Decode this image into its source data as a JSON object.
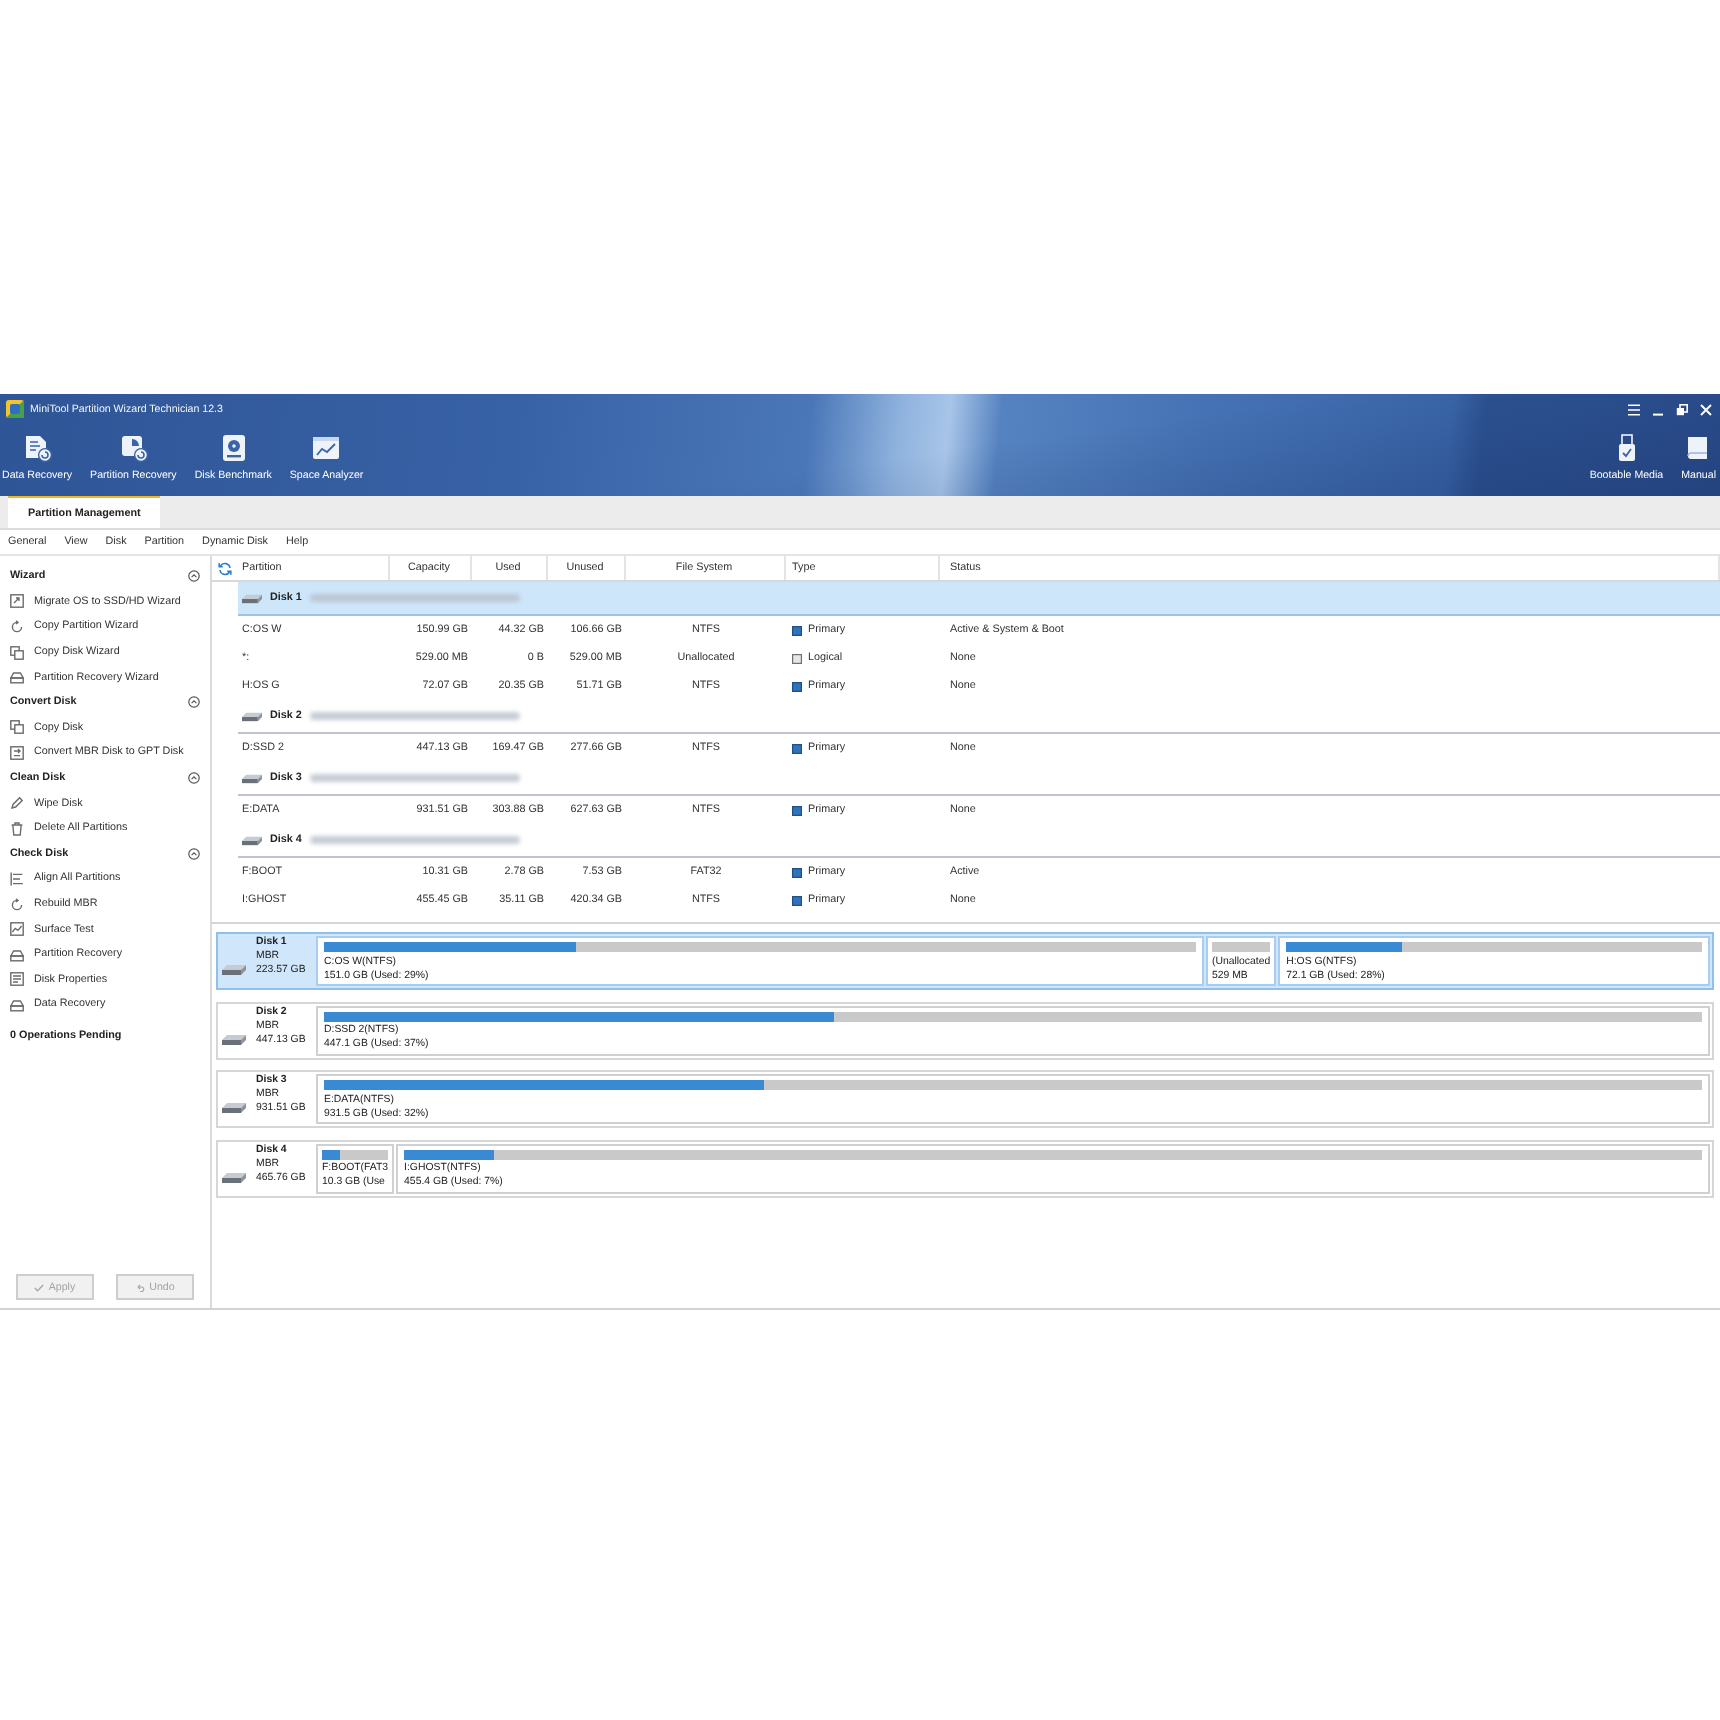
{
  "window": {
    "title": "MiniTool Partition Wizard Technician 12.3"
  },
  "toolbar": [
    "Data Recovery",
    "Partition Recovery",
    "Disk Benchmark",
    "Space Analyzer"
  ],
  "toolbar_right": [
    "Bootable Media",
    "Manual"
  ],
  "tabs": [
    {
      "label": "Partition Management",
      "selected": true
    }
  ],
  "menu": [
    "General",
    "View",
    "Disk",
    "Partition",
    "Dynamic Disk",
    "Help"
  ],
  "sidebar": {
    "groups": [
      {
        "title": "Wizard",
        "expanded": true,
        "items": [
          "Migrate OS to SSD/HD Wizard",
          "Copy Partition Wizard",
          "Copy Disk Wizard",
          "Partition Recovery Wizard"
        ]
      },
      {
        "title": "Convert Disk",
        "expanded": true,
        "items": [
          "Copy Disk",
          "Convert MBR Disk to GPT Disk"
        ]
      },
      {
        "title": "Clean Disk",
        "expanded": true,
        "items": [
          "Wipe Disk",
          "Delete All Partitions"
        ]
      },
      {
        "title": "Check Disk",
        "expanded": true,
        "items": [
          "Align All Partitions",
          "Rebuild MBR",
          "Surface Test",
          "Partition Recovery",
          "Disk Properties",
          "Data Recovery"
        ]
      }
    ],
    "pending": "0 Operations Pending",
    "buttons": [
      {
        "label": "Apply",
        "disabled": true
      },
      {
        "label": "Undo",
        "disabled": true
      }
    ]
  },
  "table": {
    "columns": [
      "Partition",
      "Capacity",
      "Used",
      "Unused",
      "File System",
      "Type",
      "Status"
    ],
    "disks": [
      {
        "name": "Disk 1",
        "selected": true,
        "partitions": [
          {
            "partition": "C:OS W",
            "capacity": "150.99 GB",
            "used": "44.32 GB",
            "unused": "106.66 GB",
            "file_system": "NTFS",
            "kind": "primary",
            "type": "Primary",
            "status": "Active & System & Boot"
          },
          {
            "partition": "*:",
            "capacity": "529.00 MB",
            "used": "0 B",
            "unused": "529.00 MB",
            "file_system": "Unallocated",
            "kind": "logical",
            "type": "Logical",
            "status": "None"
          },
          {
            "partition": "H:OS G",
            "capacity": "72.07 GB",
            "used": "20.35 GB",
            "unused": "51.71 GB",
            "file_system": "NTFS",
            "kind": "primary",
            "type": "Primary",
            "status": "None"
          }
        ]
      },
      {
        "name": "Disk 2",
        "selected": false,
        "partitions": [
          {
            "partition": "D:SSD 2",
            "capacity": "447.13 GB",
            "used": "169.47 GB",
            "unused": "277.66 GB",
            "file_system": "NTFS",
            "kind": "primary",
            "type": "Primary",
            "status": "None"
          }
        ]
      },
      {
        "name": "Disk 3",
        "selected": false,
        "partitions": [
          {
            "partition": "E:DATA",
            "capacity": "931.51 GB",
            "used": "303.88 GB",
            "unused": "627.63 GB",
            "file_system": "NTFS",
            "kind": "primary",
            "type": "Primary",
            "status": "None"
          }
        ]
      },
      {
        "name": "Disk 4",
        "selected": false,
        "partitions": [
          {
            "partition": "F:BOOT",
            "capacity": "10.31 GB",
            "used": "2.78 GB",
            "unused": "7.53 GB",
            "file_system": "FAT32",
            "kind": "primary",
            "type": "Primary",
            "status": "Active"
          },
          {
            "partition": "I:GHOST",
            "capacity": "455.45 GB",
            "used": "35.11 GB",
            "unused": "420.34 GB",
            "file_system": "NTFS",
            "kind": "primary",
            "type": "Primary",
            "status": "None"
          }
        ]
      }
    ]
  },
  "disk_map": [
    {
      "name": "Disk 1",
      "scheme": "MBR",
      "size": "223.57 GB",
      "selected": true,
      "partitions": [
        {
          "kind": "partition",
          "label": "C:OS W(NTFS)",
          "detail": "151.0 GB (Used: 29%)",
          "level": 0.29
        },
        {
          "kind": "unallocated",
          "label": "(Unallocated",
          "detail": "529 MB"
        },
        {
          "kind": "partition",
          "label": "H:OS G(NTFS)",
          "detail": "72.1 GB (Used: 28%)",
          "level": 0.28
        }
      ]
    },
    {
      "name": "Disk 2",
      "scheme": "MBR",
      "size": "447.13 GB",
      "selected": false,
      "partitions": [
        {
          "kind": "partition",
          "label": "D:SSD 2(NTFS)",
          "detail": "447.1 GB (Used: 37%)",
          "level": 0.37
        }
      ]
    },
    {
      "name": "Disk 3",
      "scheme": "MBR",
      "size": "931.51 GB",
      "selected": false,
      "partitions": [
        {
          "kind": "partition",
          "label": "E:DATA(NTFS)",
          "detail": "931.5 GB (Used: 32%)",
          "level": 0.32
        }
      ]
    },
    {
      "name": "Disk 4",
      "scheme": "MBR",
      "size": "465.76 GB",
      "selected": false,
      "partitions": [
        {
          "kind": "partition",
          "label": "F:BOOT(FAT3",
          "detail": "10.3 GB (Use",
          "level": 0.27
        },
        {
          "kind": "partition",
          "label": "I:GHOST(NTFS)",
          "detail": "455.4 GB (Used: 7%)",
          "level": 0.07
        }
      ]
    }
  ]
}
